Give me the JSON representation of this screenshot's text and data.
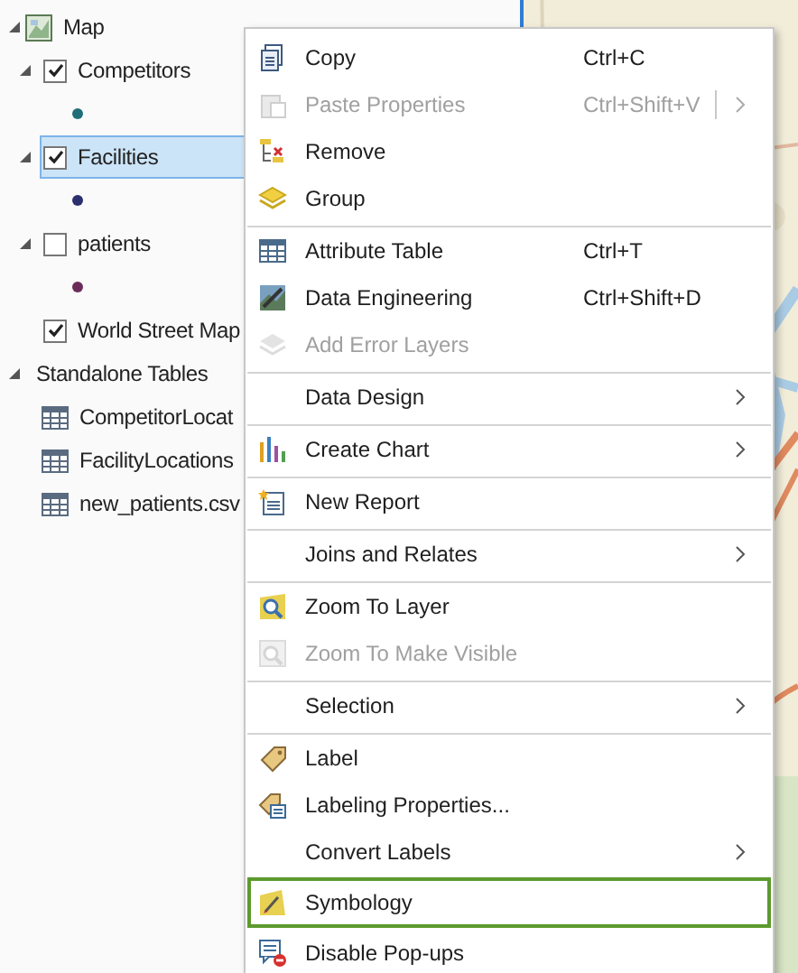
{
  "contents_tree": [
    {
      "label": "Map",
      "kind": "map",
      "expanded": true,
      "children": [
        {
          "label": "Competitors",
          "kind": "layer",
          "checked": true,
          "expanded": true,
          "selected": false,
          "children": [
            {
              "kind": "symbol",
              "color": "#1f6e7a"
            }
          ]
        },
        {
          "label": "Facilities",
          "kind": "layer",
          "checked": true,
          "expanded": true,
          "selected": true,
          "children": [
            {
              "kind": "symbol",
              "color": "#2b2f6e"
            }
          ]
        },
        {
          "label": "patients",
          "kind": "layer",
          "checked": false,
          "expanded": true,
          "selected": false,
          "children": [
            {
              "kind": "symbol",
              "color": "#6b2c5a"
            }
          ]
        },
        {
          "label": "World Street Map",
          "kind": "basemap",
          "checked": true,
          "selected": false
        }
      ]
    },
    {
      "label": "Standalone Tables",
      "kind": "group",
      "expanded": true,
      "children": [
        {
          "label": "CompetitorLocat",
          "kind": "table"
        },
        {
          "label": "FacilityLocations",
          "kind": "table"
        },
        {
          "label": "new_patients.csv",
          "kind": "table"
        }
      ]
    }
  ],
  "context_menu": [
    {
      "label": "Copy",
      "shortcut": "Ctrl+C",
      "disabled": false,
      "submenu": false,
      "separator_before": false,
      "selected": false
    },
    {
      "label": "Paste Properties",
      "shortcut": "Ctrl+Shift+V",
      "disabled": true,
      "submenu": true,
      "separator_before": false,
      "selected": false
    },
    {
      "label": "Remove",
      "disabled": false,
      "submenu": false,
      "separator_before": false,
      "selected": false
    },
    {
      "label": "Group",
      "disabled": false,
      "submenu": false,
      "separator_before": false,
      "selected": false
    },
    {
      "label": "Attribute Table",
      "shortcut": "Ctrl+T",
      "disabled": false,
      "submenu": false,
      "separator_before": true,
      "selected": false
    },
    {
      "label": "Data Engineering",
      "shortcut": "Ctrl+Shift+D",
      "disabled": false,
      "submenu": false,
      "separator_before": false,
      "selected": false
    },
    {
      "label": "Add Error Layers",
      "disabled": true,
      "submenu": false,
      "separator_before": false,
      "selected": false
    },
    {
      "label": "Data Design",
      "disabled": false,
      "submenu": true,
      "separator_before": true,
      "selected": false
    },
    {
      "label": "Create Chart",
      "disabled": false,
      "submenu": true,
      "separator_before": true,
      "selected": false
    },
    {
      "label": "New Report",
      "disabled": false,
      "submenu": false,
      "separator_before": true,
      "selected": false
    },
    {
      "label": "Joins and Relates",
      "disabled": false,
      "submenu": true,
      "separator_before": true,
      "selected": false
    },
    {
      "label": "Zoom To Layer",
      "disabled": false,
      "submenu": false,
      "separator_before": true,
      "selected": false
    },
    {
      "label": "Zoom To Make Visible",
      "disabled": true,
      "submenu": false,
      "separator_before": false,
      "selected": false
    },
    {
      "label": "Selection",
      "disabled": false,
      "submenu": true,
      "separator_before": true,
      "selected": false
    },
    {
      "label": "Label",
      "disabled": false,
      "submenu": false,
      "separator_before": true,
      "selected": false
    },
    {
      "label": "Labeling Properties...",
      "disabled": false,
      "submenu": false,
      "separator_before": false,
      "selected": false
    },
    {
      "label": "Convert Labels",
      "disabled": false,
      "submenu": true,
      "separator_before": false,
      "selected": false
    },
    {
      "label": "Symbology",
      "disabled": false,
      "submenu": false,
      "separator_before": false,
      "selected": true
    },
    {
      "label": "Disable Pop-ups",
      "disabled": false,
      "submenu": false,
      "separator_before": false,
      "selected": false
    }
  ]
}
